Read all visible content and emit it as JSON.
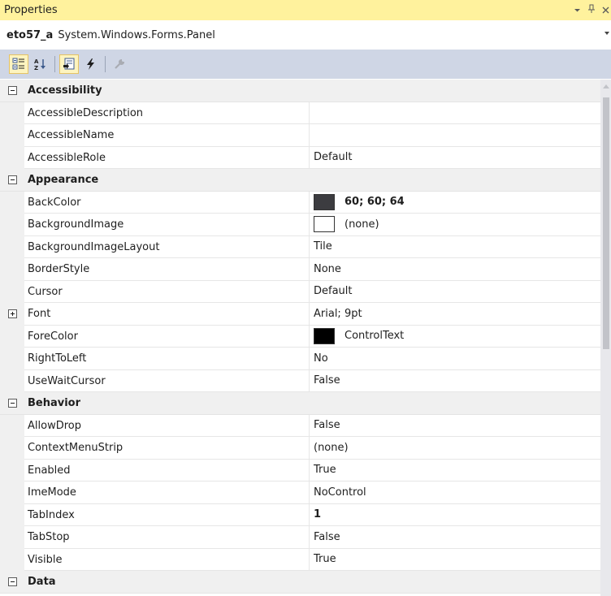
{
  "window": {
    "title": "Properties",
    "pin_glyph": "▾ ⊥",
    "close_glyph": "×"
  },
  "object_selector": {
    "name": "eto57_a",
    "type": "System.Windows.Forms.Panel"
  },
  "toolbar": {
    "buttons": [
      {
        "icon": "categorized-icon",
        "active": true
      },
      {
        "icon": "alphabetical-icon",
        "active": false
      },
      {
        "icon": "properties-icon",
        "active": true
      },
      {
        "icon": "events-icon",
        "active": false
      },
      {
        "icon": "property-pages-icon",
        "active": false,
        "disabled": true
      }
    ]
  },
  "categories": {
    "accessibility": "Accessibility",
    "appearance": "Appearance",
    "behavior": "Behavior",
    "data": "Data"
  },
  "props": {
    "accessible_description": {
      "name": "AccessibleDescription",
      "value": ""
    },
    "accessible_name": {
      "name": "AccessibleName",
      "value": ""
    },
    "accessible_role": {
      "name": "AccessibleRole",
      "value": "Default"
    },
    "back_color": {
      "name": "BackColor",
      "value": "60; 60; 64",
      "swatch": "#3c3c40"
    },
    "background_image": {
      "name": "BackgroundImage",
      "value": "(none)",
      "swatch": "#ffffff"
    },
    "background_image_layout": {
      "name": "BackgroundImageLayout",
      "value": "Tile"
    },
    "border_style": {
      "name": "BorderStyle",
      "value": "None"
    },
    "cursor": {
      "name": "Cursor",
      "value": "Default"
    },
    "font": {
      "name": "Font",
      "value": "Arial; 9pt"
    },
    "fore_color": {
      "name": "ForeColor",
      "value": "ControlText",
      "swatch": "#000000"
    },
    "right_to_left": {
      "name": "RightToLeft",
      "value": "No"
    },
    "use_wait_cursor": {
      "name": "UseWaitCursor",
      "value": "False"
    },
    "allow_drop": {
      "name": "AllowDrop",
      "value": "False"
    },
    "context_menu_strip": {
      "name": "ContextMenuStrip",
      "value": "(none)"
    },
    "enabled": {
      "name": "Enabled",
      "value": "True"
    },
    "ime_mode": {
      "name": "ImeMode",
      "value": "NoControl"
    },
    "tab_index": {
      "name": "TabIndex",
      "value": "1"
    },
    "tab_stop": {
      "name": "TabStop",
      "value": "False"
    },
    "visible": {
      "name": "Visible",
      "value": "True"
    }
  },
  "colors": {
    "title_bar": "#fff29d",
    "toolbar": "#cfd6e5",
    "category_bg": "#f0f0f0",
    "grid_line": "#e6e6e6"
  }
}
